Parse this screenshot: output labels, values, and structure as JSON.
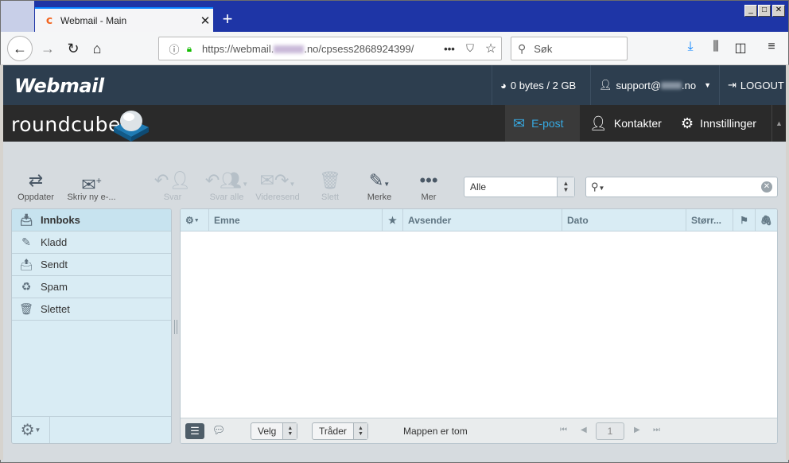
{
  "browser": {
    "tab_title": "Webmail - Main",
    "tab_favicon": "cpanel-icon",
    "new_tab": "+",
    "url_prefix": "https://webmail.",
    "url_suffix": ".no/cpsess2868924399/",
    "url_more": "•••",
    "search_placeholder": "Søk"
  },
  "webmail": {
    "logo": "Webmail",
    "quota": "0 bytes / 2 GB",
    "user_prefix": "support@",
    "user_suffix": ".no",
    "logout": "LOGOUT"
  },
  "roundcube": {
    "logo": "roundcube",
    "nav": [
      {
        "label": "E-post",
        "icon": "envelope-icon",
        "active": true
      },
      {
        "label": "Kontakter",
        "icon": "user-icon",
        "active": false
      },
      {
        "label": "Innstillinger",
        "icon": "gear-icon",
        "active": false
      }
    ]
  },
  "toolbar": {
    "refresh": "Oppdater",
    "compose": "Skriv ny e-...",
    "reply": "Svar",
    "reply_all": "Svar alle",
    "forward": "Videresend",
    "delete": "Slett",
    "mark": "Merke",
    "more": "Mer",
    "filter_value": "Alle"
  },
  "folders": [
    {
      "label": "Innboks",
      "icon": "inbox-icon",
      "selected": true
    },
    {
      "label": "Kladd",
      "icon": "pencil-icon",
      "selected": false
    },
    {
      "label": "Sendt",
      "icon": "sent-icon",
      "selected": false
    },
    {
      "label": "Spam",
      "icon": "spam-icon",
      "selected": false
    },
    {
      "label": "Slettet",
      "icon": "trash-icon",
      "selected": false
    }
  ],
  "messagelist": {
    "columns": {
      "subject": "Emne",
      "from": "Avsender",
      "date": "Dato",
      "size": "Størr..."
    },
    "select_label": "Velg",
    "threads_label": "Tråder",
    "empty_text": "Mappen er tom",
    "page": "1"
  },
  "colors": {
    "header_bg": "#2d3e4f",
    "nav_bg": "#2a2a2a",
    "accent": "#37a8e0",
    "panel_bg": "#d9ecf4"
  }
}
